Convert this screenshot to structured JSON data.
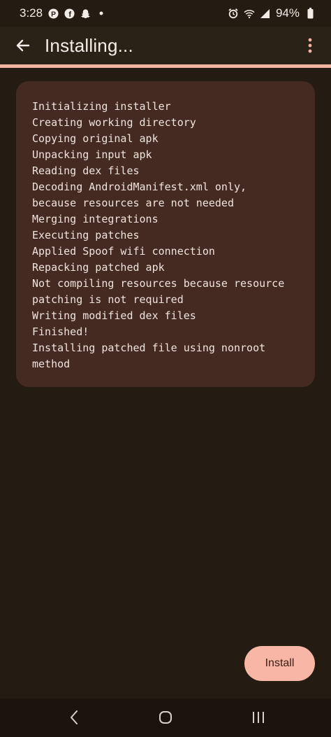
{
  "status_bar": {
    "time": "3:28",
    "battery": "94%",
    "left_icons": [
      "pinterest-icon",
      "facebook-icon",
      "snapchat-icon",
      "dot-icon"
    ],
    "right_icons": [
      "alarm-icon",
      "wifi-icon",
      "signal-icon",
      "battery-icon"
    ]
  },
  "app_bar": {
    "title": "Installing...",
    "back_icon": "arrow-left-icon",
    "menu_icon": "more-vert-icon"
  },
  "progress": {
    "fraction": 1.0
  },
  "log": {
    "lines": [
      "Initializing installer",
      "Creating working directory",
      "Copying original apk",
      "Unpacking input apk",
      "Reading dex files",
      "Decoding AndroidManifest.xml only,",
      "because resources are not needed",
      "Merging integrations",
      "Executing patches",
      "Applied Spoof wifi connection",
      "Repacking patched apk",
      "Not compiling resources because resource",
      "patching is not required",
      "Writing modified dex files",
      "Finished!",
      "Installing patched file using nonroot",
      "method"
    ]
  },
  "actions": {
    "install_label": "Install"
  },
  "nav_bar": {
    "icons": [
      "back-nav-icon",
      "home-nav-icon",
      "recents-nav-icon"
    ]
  },
  "colors": {
    "background": "#241c12",
    "card": "#442a20",
    "accent": "#f7b6a6",
    "progress": "#f4b4a3"
  }
}
